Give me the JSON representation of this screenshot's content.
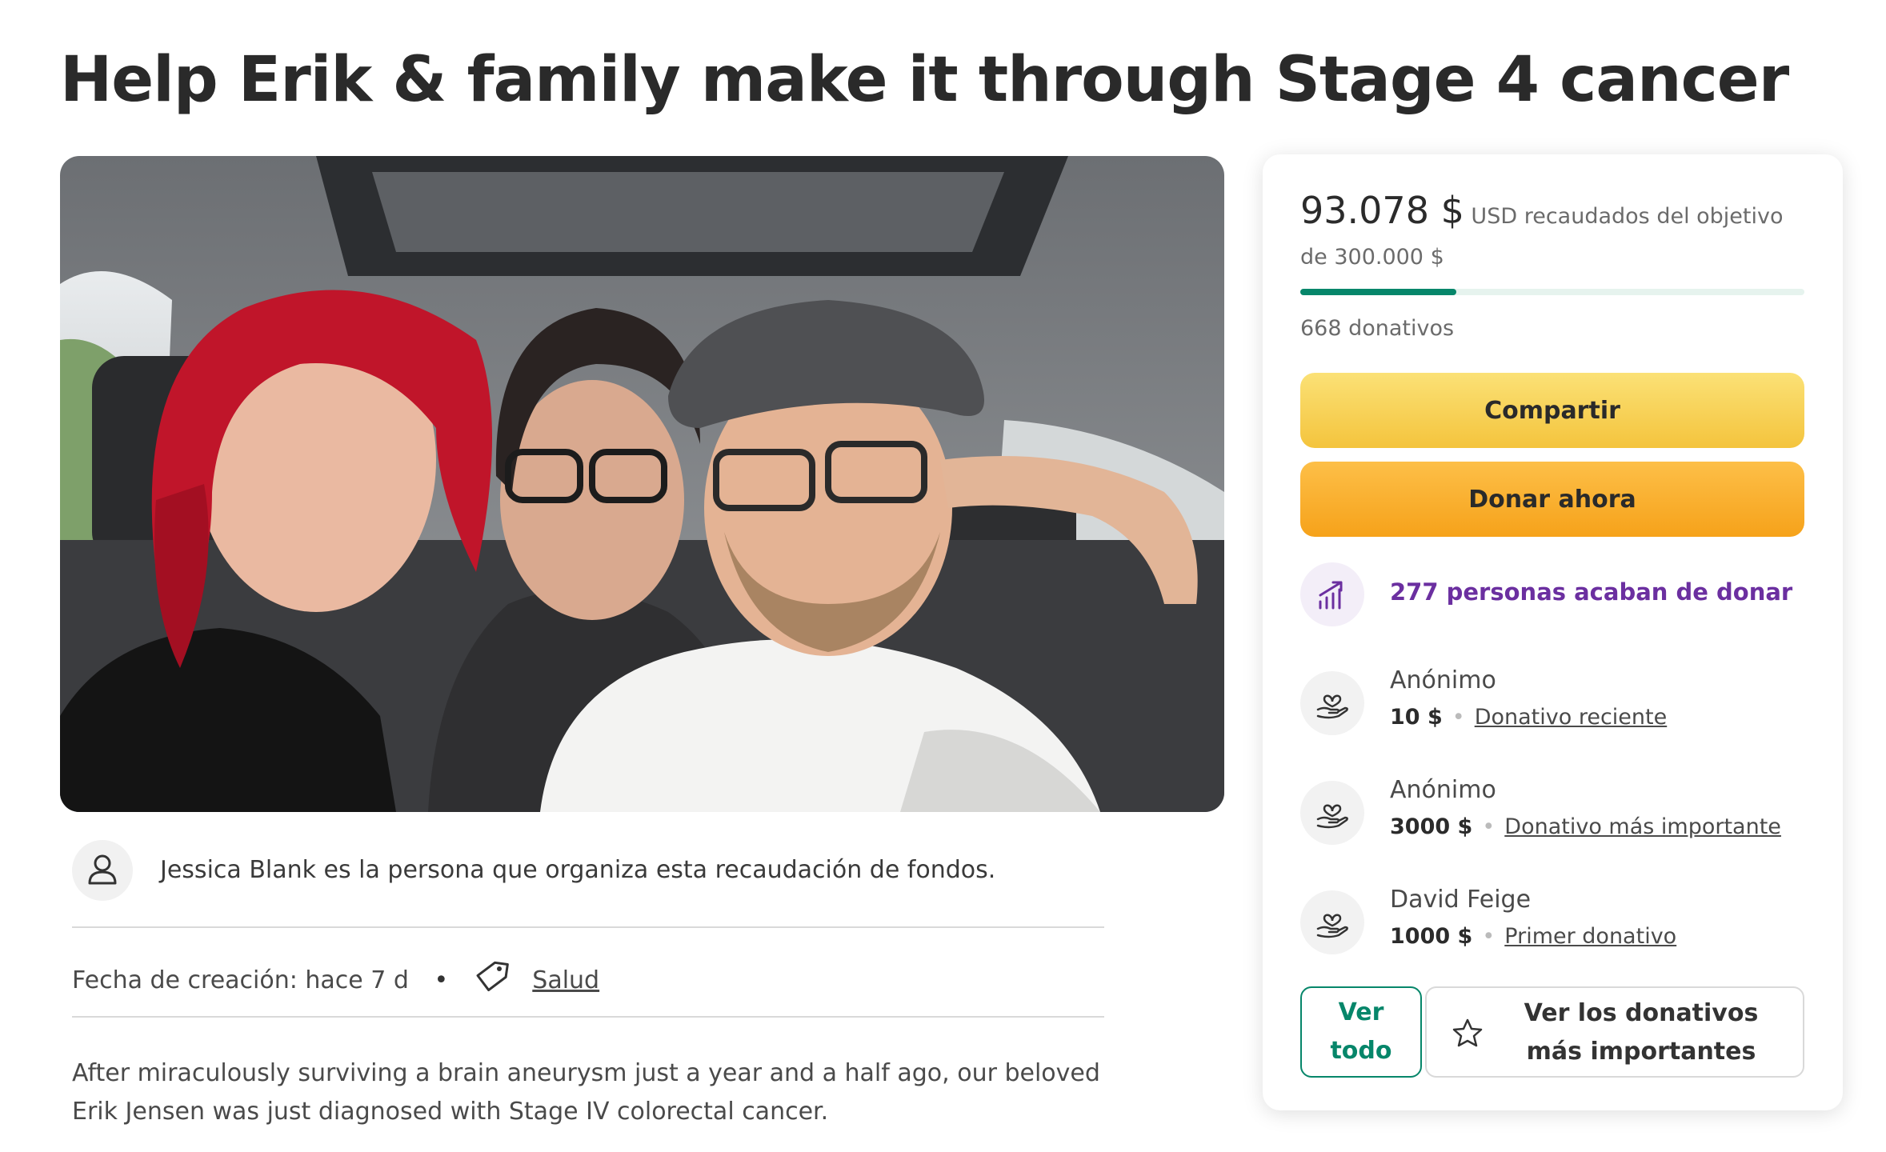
{
  "campaign": {
    "title": "Help Erik & family make it through Stage 4 cancer",
    "organizer_text": "Jessica Blank es la persona que organiza esta recaudación de fondos.",
    "created_label": "Fecha de creación: hace 7 d",
    "category": "Salud",
    "story": "After miraculously surviving a brain aneurysm just a year and a half ago, our beloved Erik Jensen was just diagnosed with Stage IV colorectal cancer."
  },
  "sidebar": {
    "raised_amount": "93.078 $",
    "raised_text": " USD recaudados del objetivo de 300.000 $",
    "progress_fraction": 0.31,
    "donations_count": "668 donativos",
    "share_label": "Compartir",
    "donate_label": "Donar ahora",
    "trend_text": "277 personas acaban de donar",
    "donors": [
      {
        "name": "Anónimo",
        "amount": "10 $",
        "badge": "Donativo reciente"
      },
      {
        "name": "Anónimo",
        "amount": "3000 $",
        "badge": "Donativo más importante"
      },
      {
        "name": "David Feige",
        "amount": "1000 $",
        "badge": "Primer donativo"
      }
    ],
    "see_all_label": "Ver todo",
    "see_top_label": "Ver los donativos más importantes"
  },
  "colors": {
    "accent_green": "#06866a",
    "share_yellow": "#f4c43d",
    "donate_orange": "#f6a21a",
    "trend_purple": "#6b2fa0"
  },
  "icons": [
    "user-icon",
    "tag-icon",
    "trend-up-icon",
    "donation-hand-icon",
    "star-icon"
  ]
}
